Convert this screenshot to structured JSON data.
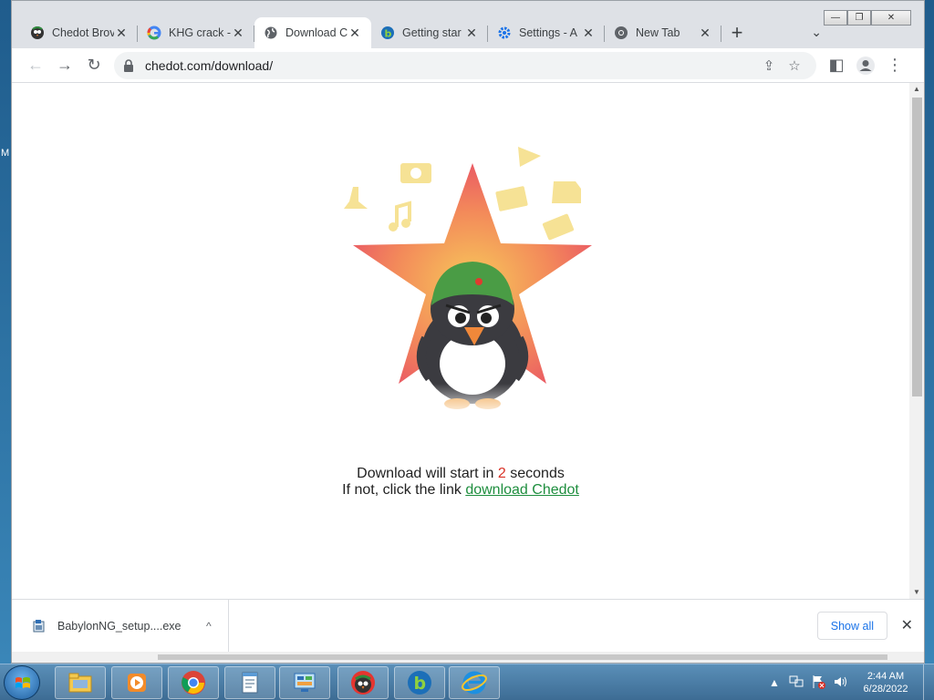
{
  "desktop": {
    "edge_label": "M"
  },
  "window": {
    "controls": {
      "minimize": "—",
      "restore": "❐",
      "close": "✕"
    }
  },
  "tabs": [
    {
      "title": "Chedot Brov",
      "favicon": "chedot-penguin-icon",
      "active": false
    },
    {
      "title": "KHG crack -",
      "favicon": "google-icon",
      "active": false
    },
    {
      "title": "Download C",
      "favicon": "globe-icon",
      "active": true
    },
    {
      "title": "Getting star",
      "favicon": "babylon-icon",
      "active": false
    },
    {
      "title": "Settings - A",
      "favicon": "settings-gear-icon",
      "active": false
    },
    {
      "title": "New Tab",
      "favicon": "chrome-icon",
      "active": false
    }
  ],
  "tab_close_glyph": "✕",
  "new_tab_glyph": "+",
  "tab_list_glyph": "⌄",
  "toolbar": {
    "back_glyph": "←",
    "forward_glyph": "→",
    "reload_glyph": "↻",
    "url": "chedot.com/download/",
    "share_glyph": "⇪",
    "star_glyph": "☆",
    "side_panel_glyph": "◧",
    "menu_glyph": "⋮"
  },
  "page": {
    "line1_prefix": "Download will start in ",
    "countdown": "2",
    "line1_suffix": " seconds",
    "line2_prefix": "If not, click the link ",
    "link_text": "download Chedot",
    "colors": {
      "countdown": "#d93025",
      "link": "#1e8e3e"
    }
  },
  "download_bar": {
    "filename": "BabylonNG_setup....exe",
    "caret_glyph": "^",
    "show_all_label": "Show all",
    "close_glyph": "✕"
  },
  "taskbar": {
    "apps": [
      "explorer-icon",
      "media-player-icon",
      "chrome-icon",
      "notepad-icon",
      "control-panel-icon",
      "chedot-penguin-icon",
      "babylon-icon",
      "internet-explorer-icon"
    ],
    "tray": {
      "up_glyph": "▲",
      "time": "2:44 AM",
      "date": "6/28/2022"
    }
  }
}
